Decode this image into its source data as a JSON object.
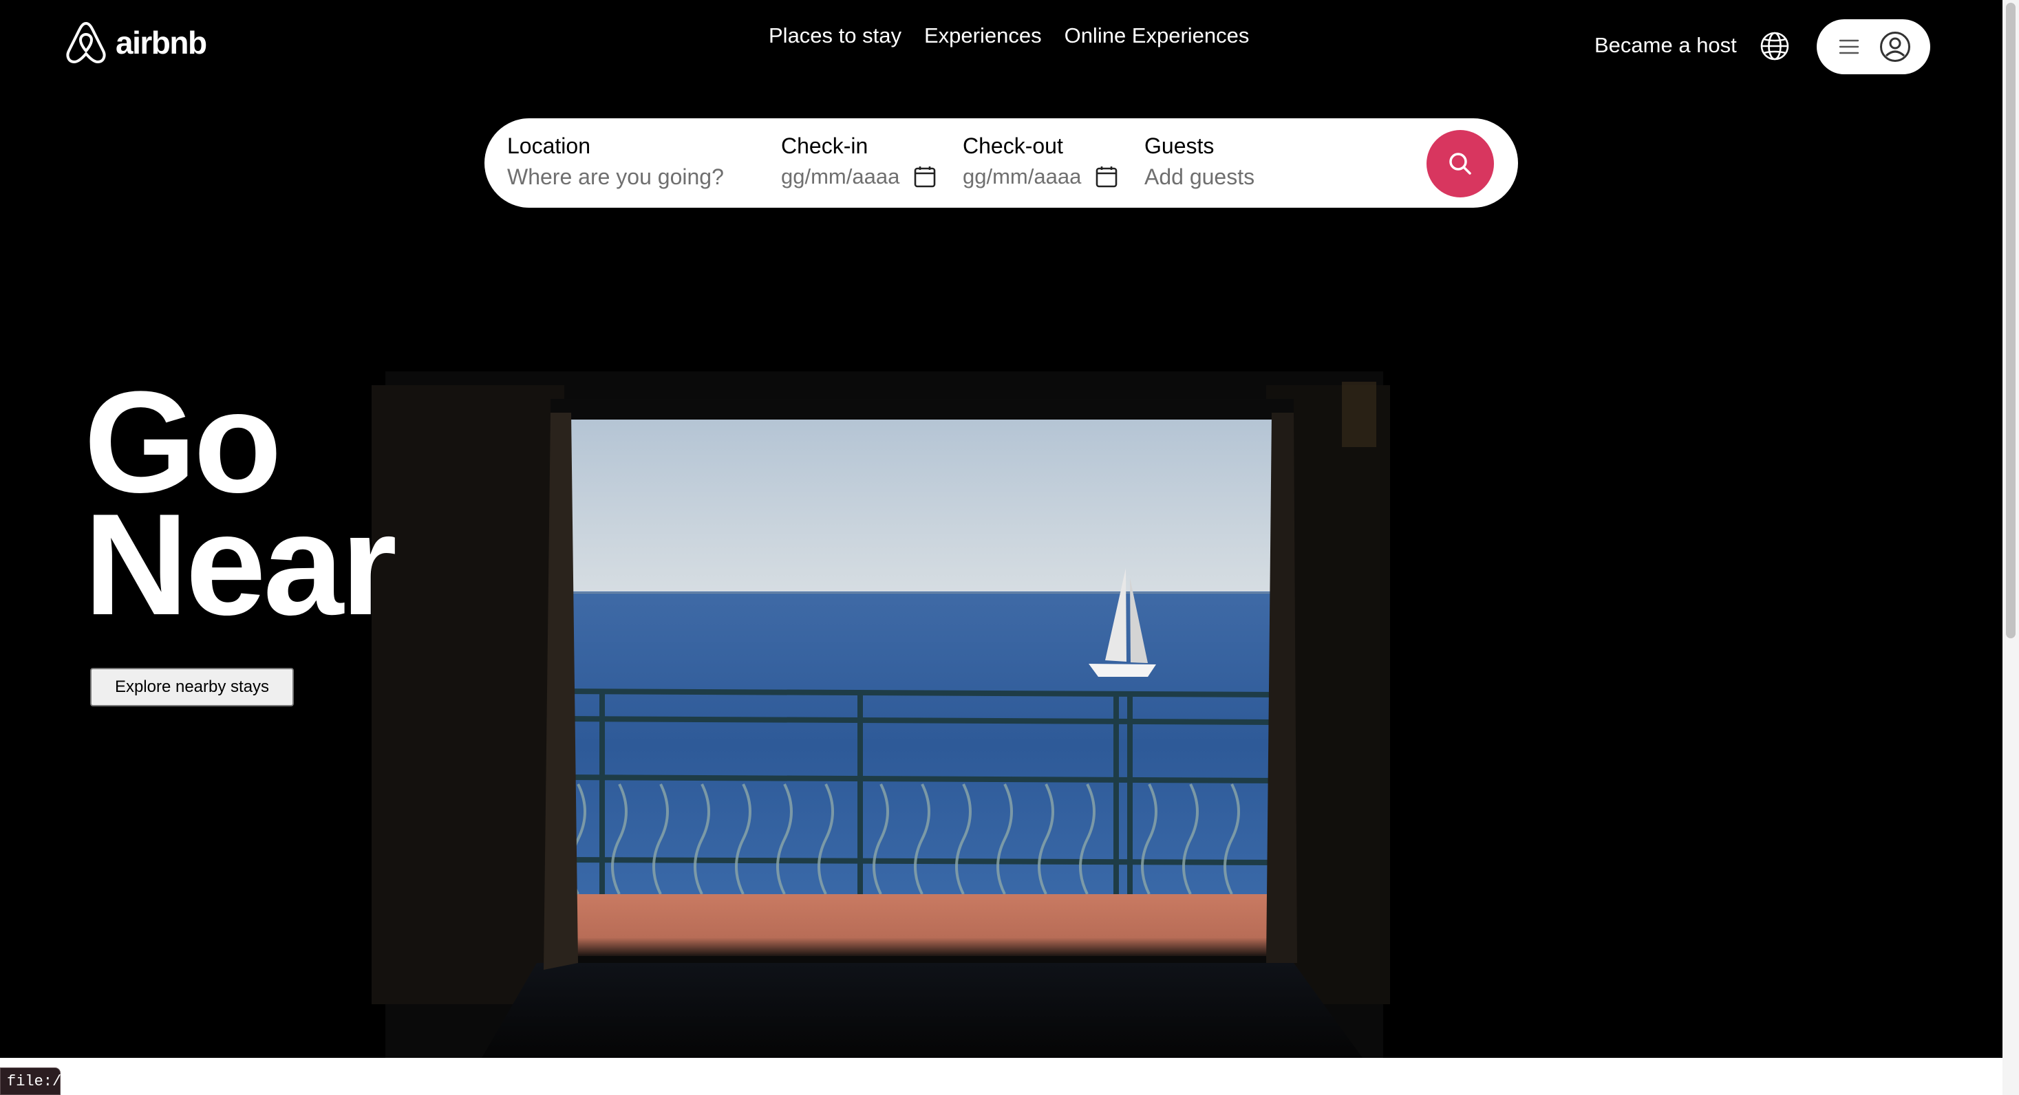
{
  "brand": {
    "name": "airbnb",
    "color": "#d8365f"
  },
  "nav": {
    "items": [
      "Places to stay",
      "Experiences",
      "Online Experiences"
    ]
  },
  "header": {
    "host_link": "Became a host",
    "globe_icon": "globe-icon",
    "menu_icon": "hamburger-menu-icon",
    "avatar_icon": "user-avatar-icon"
  },
  "search": {
    "location": {
      "label": "Location",
      "placeholder": "Where are you going?"
    },
    "checkin": {
      "label": "Check-in",
      "value": "gg/mm/aaaa",
      "icon": "calendar-icon"
    },
    "checkout": {
      "label": "Check-out",
      "value": "gg/mm/aaaa",
      "icon": "calendar-icon"
    },
    "guests": {
      "label": "Guests",
      "placeholder": "Add guests"
    },
    "button_icon": "search-icon"
  },
  "hero": {
    "title_line1": "Go",
    "title_line2": "Near",
    "cta": "Explore nearby stays"
  },
  "status_bar": {
    "url": "file:///"
  }
}
